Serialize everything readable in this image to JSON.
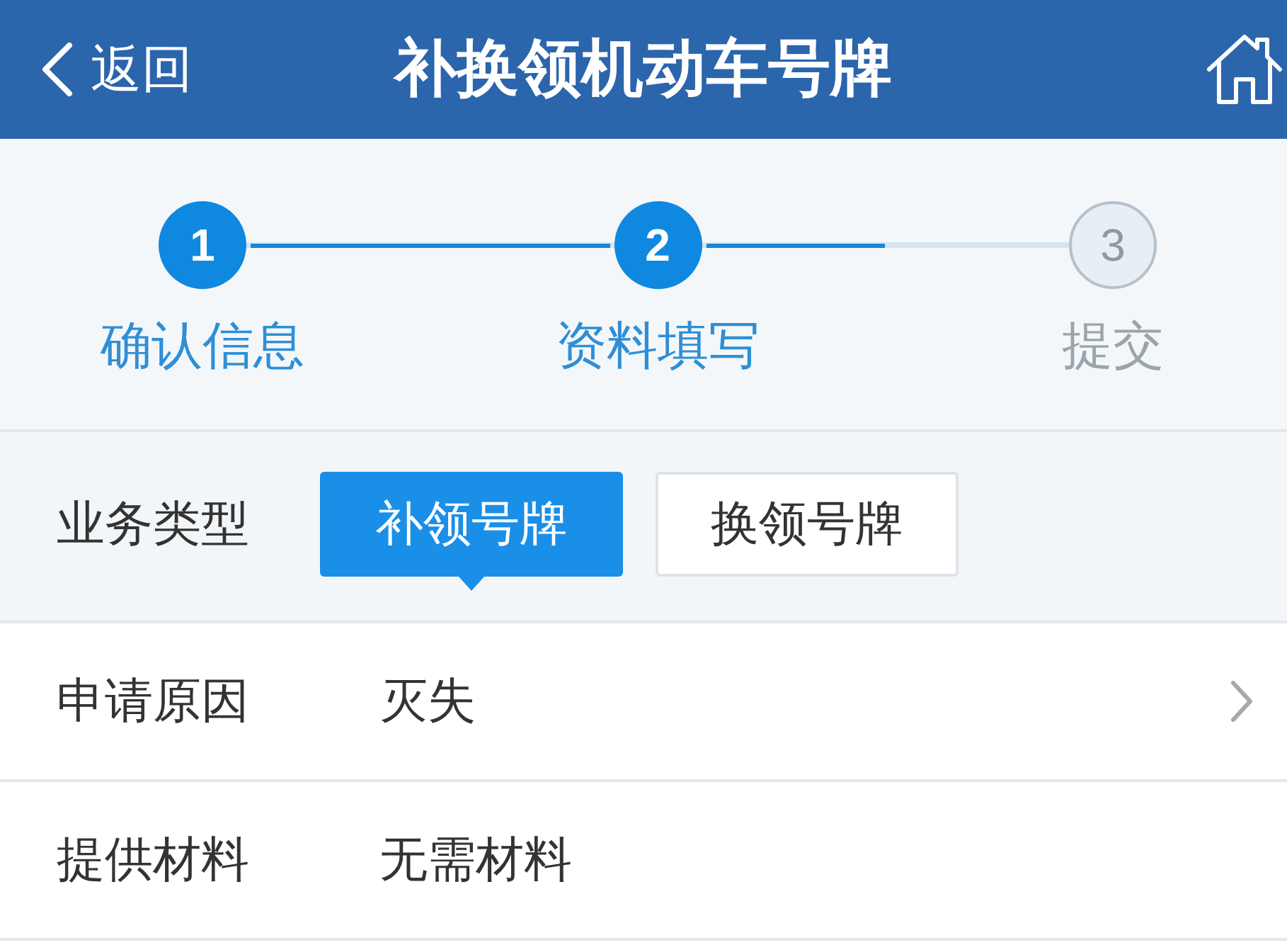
{
  "header": {
    "back": "返回",
    "title": "补换领机动车号牌"
  },
  "steps": {
    "items": [
      {
        "number": "1",
        "label": "确认信息",
        "active": true
      },
      {
        "number": "2",
        "label": "资料填写",
        "active": true
      },
      {
        "number": "3",
        "label": "提交",
        "active": false
      }
    ],
    "connectors": [
      {
        "level": 1
      },
      {
        "level": 0.5
      }
    ]
  },
  "business_type": {
    "label": "业务类型",
    "options": [
      {
        "label": "补领号牌",
        "selected": true
      },
      {
        "label": "换领号牌",
        "selected": false
      }
    ]
  },
  "rows": [
    {
      "kind": "select",
      "label": "申请原因",
      "value": "灭失"
    },
    {
      "kind": "static",
      "label": "提供材料",
      "value": "无需材料"
    }
  ]
}
